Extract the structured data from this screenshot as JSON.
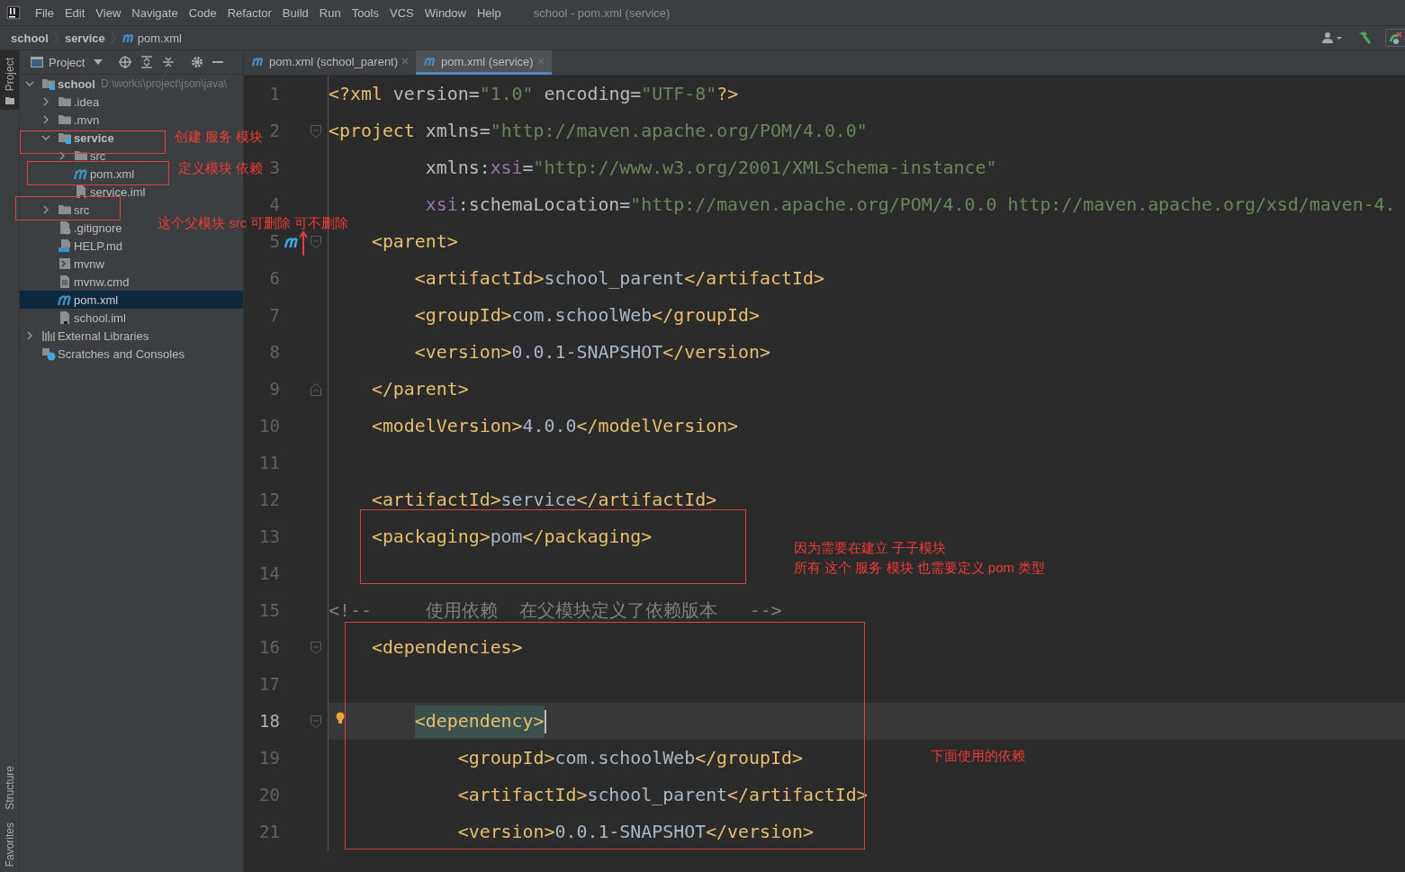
{
  "menu": {
    "items": [
      "File",
      "Edit",
      "View",
      "Navigate",
      "Code",
      "Refactor",
      "Build",
      "Run",
      "Tools",
      "VCS",
      "Window",
      "Help"
    ],
    "title": "school - pom.xml (service)"
  },
  "breadcrumb": [
    "school",
    "service",
    "pom.xml"
  ],
  "side_stripe": {
    "top": [
      {
        "label": "Project",
        "selected": true
      }
    ],
    "bottom": [
      {
        "label": "Structure",
        "selected": false
      },
      {
        "label": "Favorites",
        "selected": false
      }
    ]
  },
  "project": {
    "header": "Project",
    "tree": [
      {
        "label": "school",
        "kind": "module",
        "path": "D:\\works\\project\\json\\java\\",
        "expanded": true,
        "selected": false,
        "children": [
          {
            "label": ".idea",
            "kind": "folder",
            "expanded": false,
            "selected": false
          },
          {
            "label": ".mvn",
            "kind": "folder",
            "expanded": false,
            "selected": false
          },
          {
            "label": "service",
            "kind": "module",
            "expanded": true,
            "selected": false,
            "children": [
              {
                "label": "src",
                "kind": "folder",
                "expanded": false,
                "selected": false
              },
              {
                "label": "pom.xml",
                "kind": "maven",
                "selected": false
              },
              {
                "label": "service.iml",
                "kind": "iml",
                "selected": false
              }
            ]
          },
          {
            "label": "src",
            "kind": "folder",
            "expanded": false,
            "selected": false
          },
          {
            "label": ".gitignore",
            "kind": "ignore",
            "selected": false
          },
          {
            "label": "HELP.md",
            "kind": "md",
            "selected": false
          },
          {
            "label": "mvnw",
            "kind": "script",
            "selected": false
          },
          {
            "label": "mvnw.cmd",
            "kind": "text",
            "selected": false
          },
          {
            "label": "pom.xml",
            "kind": "maven",
            "selected": true
          },
          {
            "label": "school.iml",
            "kind": "iml",
            "selected": false
          }
        ]
      },
      {
        "label": "External Libraries",
        "kind": "libraries",
        "expanded": false,
        "selected": false
      },
      {
        "label": "Scratches and Consoles",
        "kind": "scratches",
        "selected": false
      }
    ]
  },
  "tabs": [
    {
      "label": "pom.xml (school_parent)",
      "selected": false
    },
    {
      "label": "pom.xml (service)",
      "selected": true
    }
  ],
  "editor": {
    "lines": [
      {
        "number": "1",
        "kind": "plain",
        "current": false,
        "segments": [
          {
            "kind": "tag",
            "text": "<?xml"
          },
          {
            "kind": "attr",
            "text": " version"
          },
          {
            "kind": "text",
            "text": "="
          },
          {
            "kind": "value",
            "text": "\"1.0\""
          },
          {
            "kind": "attr",
            "text": " encoding"
          },
          {
            "kind": "text",
            "text": "="
          },
          {
            "kind": "value",
            "text": "\"UTF-8\""
          },
          {
            "kind": "tag",
            "text": "?>"
          }
        ]
      },
      {
        "number": "2",
        "kind": "plain",
        "current": false,
        "segments": [
          {
            "kind": "open",
            "text": "<project"
          },
          {
            "kind": "attr",
            "text": " xmlns"
          },
          {
            "kind": "text",
            "text": "="
          },
          {
            "kind": "value",
            "text": "\"http://maven.apache.org/POM/4.0.0\""
          }
        ]
      },
      {
        "number": "3",
        "kind": "plain",
        "current": false,
        "segments": [
          {
            "kind": "attr",
            "text": "         xmlns:"
          },
          {
            "kind": "ns",
            "text": "xsi"
          },
          {
            "kind": "text",
            "text": "="
          },
          {
            "kind": "value",
            "text": "\"http://www.w3.org/2001/XMLSchema-instance\""
          }
        ]
      },
      {
        "number": "4",
        "kind": "plain",
        "current": false,
        "segments": [
          {
            "kind": "ns",
            "text": "         xsi"
          },
          {
            "kind": "attr",
            "text": ":schemaLocation"
          },
          {
            "kind": "text",
            "text": "="
          },
          {
            "kind": "value",
            "text": "\"http://maven.apache.org/POM/4.0.0 http://maven.apache.org/xsd/maven-4."
          }
        ]
      },
      {
        "number": "5",
        "kind": "parent",
        "current": false,
        "segments": [
          {
            "kind": "open",
            "text": "    <parent>"
          }
        ]
      },
      {
        "number": "6",
        "kind": "plain",
        "current": false,
        "segments": [
          {
            "kind": "tag",
            "text": "        <artifactId>"
          },
          {
            "kind": "text",
            "text": "school_parent"
          },
          {
            "kind": "tag",
            "text": "</artifactId>"
          }
        ]
      },
      {
        "number": "7",
        "kind": "plain",
        "current": false,
        "segments": [
          {
            "kind": "tag",
            "text": "        <groupId>"
          },
          {
            "kind": "text",
            "text": "com.schoolWeb"
          },
          {
            "kind": "tag",
            "text": "</groupId>"
          }
        ]
      },
      {
        "number": "8",
        "kind": "plain",
        "current": false,
        "segments": [
          {
            "kind": "tag",
            "text": "        <version>"
          },
          {
            "kind": "text",
            "text": "0.0.1-SNAPSHOT"
          },
          {
            "kind": "tag",
            "text": "</version>"
          }
        ]
      },
      {
        "number": "9",
        "kind": "plain",
        "current": false,
        "segments": [
          {
            "kind": "close",
            "text": "    </parent>"
          }
        ]
      },
      {
        "number": "10",
        "kind": "plain",
        "current": false,
        "segments": [
          {
            "kind": "tag",
            "text": "    <modelVersion>"
          },
          {
            "kind": "text",
            "text": "4.0.0"
          },
          {
            "kind": "tag",
            "text": "</modelVersion>"
          }
        ]
      },
      {
        "number": "11",
        "kind": "plain",
        "current": false
      },
      {
        "number": "12",
        "kind": "plain",
        "current": false,
        "segments": [
          {
            "kind": "tag",
            "text": "    <artifactId>"
          },
          {
            "kind": "text",
            "text": "service"
          },
          {
            "kind": "tag",
            "text": "</artifactId>"
          }
        ]
      },
      {
        "number": "13",
        "kind": "plain",
        "current": false,
        "segments": [
          {
            "kind": "tag",
            "text": "    <packaging>"
          },
          {
            "kind": "text",
            "text": "pom"
          },
          {
            "kind": "tag",
            "text": "</packaging>"
          }
        ]
      },
      {
        "number": "14",
        "kind": "plain",
        "current": false
      },
      {
        "number": "15",
        "kind": "plain",
        "current": false,
        "segments": [
          {
            "kind": "comment",
            "text": "<!--     使用依赖  在父模块定义了依赖版本   -->"
          }
        ]
      },
      {
        "number": "16",
        "kind": "plain",
        "current": false,
        "segments": [
          {
            "kind": "open",
            "text": "    <dependencies>"
          }
        ]
      },
      {
        "number": "17",
        "kind": "plain",
        "current": false
      },
      {
        "number": "18",
        "kind": "intention",
        "current": true,
        "segments": [
          {
            "kind": "match-open",
            "text": "        <dependency>"
          }
        ]
      },
      {
        "number": "19",
        "kind": "plain",
        "current": false,
        "segments": [
          {
            "kind": "tag",
            "text": "            <groupId>"
          },
          {
            "kind": "text",
            "text": "com.schoolWeb"
          },
          {
            "kind": "tag",
            "text": "</groupId>"
          }
        ]
      },
      {
        "number": "20",
        "kind": "plain",
        "current": false,
        "segments": [
          {
            "kind": "tag",
            "text": "            <artifactId>"
          },
          {
            "kind": "text",
            "text": "school_parent"
          },
          {
            "kind": "tag",
            "text": "</artifactId>"
          }
        ]
      },
      {
        "number": "21",
        "kind": "plain",
        "current": false,
        "segments": [
          {
            "kind": "tag",
            "text": "            <version>"
          },
          {
            "kind": "text",
            "text": "0.0.1-SNAPSHOT"
          },
          {
            "kind": "tag",
            "text": "</version>"
          }
        ]
      }
    ]
  },
  "annotation_notes": [
    {
      "text": "创建 服务 模块"
    },
    {
      "text": "定义模块 依赖"
    },
    {
      "text": "这个父模块 src 可删除 可不删除"
    },
    {
      "text": "因为需要在建立 子子模块"
    },
    {
      "text": "所有 这个 服务 模块 也需要定义  pom 类型"
    },
    {
      "text": "下面使用的依赖"
    }
  ]
}
